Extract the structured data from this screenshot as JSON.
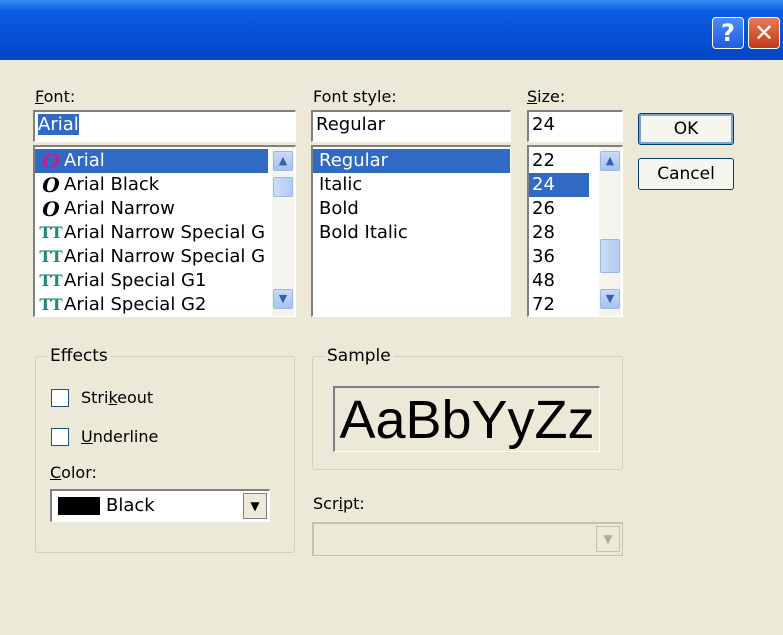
{
  "title_buttons": {
    "help": "?",
    "close": "✕"
  },
  "font": {
    "label": "Font:",
    "value": "Arial",
    "items": [
      {
        "name": "Arial",
        "icon": "opentype-icon"
      },
      {
        "name": "Arial Black",
        "icon": "opentype-icon"
      },
      {
        "name": "Arial Narrow",
        "icon": "opentype-icon"
      },
      {
        "name": "Arial Narrow Special G",
        "icon": "truetype-icon"
      },
      {
        "name": "Arial Narrow Special G",
        "icon": "truetype-icon"
      },
      {
        "name": "Arial Special G1",
        "icon": "truetype-icon"
      },
      {
        "name": "Arial Special G2",
        "icon": "truetype-icon"
      }
    ],
    "selected": "Arial"
  },
  "style": {
    "label": "Font style:",
    "value": "Regular",
    "items": [
      "Regular",
      "Italic",
      "Bold",
      "Bold Italic"
    ],
    "selected": "Regular"
  },
  "size": {
    "label": "Size:",
    "value": "24",
    "items": [
      "22",
      "24",
      "26",
      "28",
      "36",
      "48",
      "72"
    ],
    "selected": "24"
  },
  "buttons": {
    "ok": "OK",
    "cancel": "Cancel"
  },
  "effects": {
    "legend": "Effects",
    "strikeout": "Strikeout",
    "underline": "Underline",
    "color_label": "Color:",
    "color_value": "Black",
    "color_swatch": "#000000"
  },
  "sample": {
    "legend": "Sample",
    "text": "AaBbYyZz"
  },
  "script": {
    "label": "Script:",
    "value": ""
  },
  "colors": {
    "titlebar": "#0551d6",
    "selection": "#316ac5",
    "dialog_bg": "#ece9d8"
  }
}
